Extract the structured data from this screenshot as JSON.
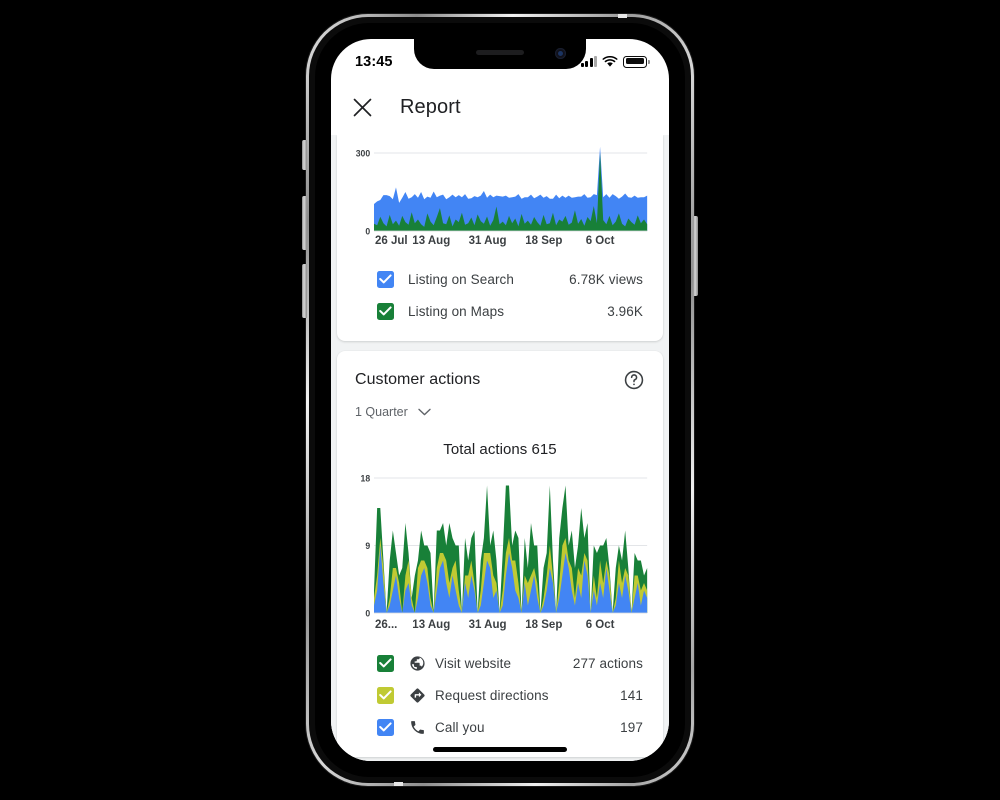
{
  "device": {
    "status_bar": {
      "time": "13:45",
      "cellular_icon": "signal-bars-icon",
      "wifi_icon": "wifi-icon",
      "battery_icon": "battery-icon"
    },
    "home_indicator": "home-indicator"
  },
  "header": {
    "close_icon": "close-icon",
    "title": "Report"
  },
  "views_card": {
    "legend": [
      {
        "label": "Listing on Search",
        "value": "6.78K views",
        "color": "#4285F4",
        "checked": true
      },
      {
        "label": "Listing on Maps",
        "value": "3.96K",
        "color": "#188038",
        "checked": true
      }
    ]
  },
  "actions_card": {
    "title": "Customer actions",
    "help_icon": "help-circle-icon",
    "period": "1 Quarter",
    "period_chevron_icon": "chevron-down-icon",
    "total": "Total actions 615",
    "legend": [
      {
        "label": "Visit website",
        "value": "277 actions",
        "color": "#188038",
        "icon": "globe-icon",
        "checked": true
      },
      {
        "label": "Request directions",
        "value": "141",
        "color": "#C0CA33",
        "icon": "directions-icon",
        "checked": true
      },
      {
        "label": "Call you",
        "value": "197",
        "color": "#4285F4",
        "icon": "phone-icon",
        "checked": true
      }
    ]
  },
  "chart_data": [
    {
      "id": "views_chart",
      "type": "area",
      "stacked": true,
      "title": "",
      "xlabel": "",
      "ylabel": "",
      "ylim": [
        0,
        300
      ],
      "yticks": [
        0,
        300
      ],
      "ytick_labels": [
        "0",
        "300"
      ],
      "grid": true,
      "legend_position": "below",
      "xtick_labels": [
        "26 Jul",
        "13 Aug",
        "31 Aug",
        "18 Sep",
        "6 Oct"
      ],
      "xtick_positions": [
        0,
        18,
        36,
        54,
        72
      ],
      "x_count": 88,
      "series": [
        {
          "name": "Listing on Maps",
          "color": "#188038",
          "values": [
            28,
            22,
            55,
            30,
            18,
            62,
            26,
            40,
            20,
            58,
            34,
            24,
            72,
            30,
            44,
            26,
            16,
            68,
            36,
            22,
            54,
            88,
            30,
            26,
            60,
            18,
            44,
            34,
            70,
            24,
            30,
            52,
            22,
            64,
            38,
            28,
            56,
            20,
            42,
            94,
            26,
            36,
            22,
            58,
            30,
            48,
            18,
            66,
            28,
            40,
            24,
            54,
            34,
            20,
            62,
            26,
            30,
            70,
            22,
            44,
            36,
            58,
            24,
            32,
            80,
            28,
            46,
            20,
            54,
            38,
            96,
            30,
            300,
            42,
            26,
            58,
            22,
            36,
            68,
            28,
            18,
            48,
            34,
            24,
            60,
            30,
            44,
            26
          ]
        },
        {
          "name": "Listing on Search",
          "color": "#4285F4",
          "values": [
            76,
            92,
            64,
            108,
            120,
            72,
            96,
            128,
            88,
            70,
            116,
            100,
            58,
            112,
            84,
            124,
            106,
            64,
            92,
            130,
            76,
            48,
            110,
            96,
            70,
            122,
            86,
            104,
            60,
            118,
            94,
            74,
            112,
            66,
            98,
            126,
            72,
            120,
            88,
            42,
            108,
            96,
            114,
            70,
            100,
            84,
            124,
            58,
            102,
            90,
            116,
            72,
            98,
            120,
            66,
            108,
            94,
            54,
            118,
            82,
            100,
            70,
            112,
            96,
            50,
            104,
            86,
            122,
            74,
            92,
            46,
            108,
            24,
            88,
            116,
            70,
            120,
            98,
            56,
            104,
            126,
            82,
            94,
            112,
            68,
            100,
            86,
            110
          ]
        }
      ]
    },
    {
      "id": "actions_chart",
      "type": "area",
      "stacked": true,
      "title": "Total actions 615",
      "xlabel": "",
      "ylabel": "",
      "ylim": [
        0,
        18
      ],
      "yticks": [
        0,
        9,
        18
      ],
      "ytick_labels": [
        "0",
        "9",
        "18"
      ],
      "grid": true,
      "legend_position": "below",
      "xtick_labels": [
        "26...",
        "13 Aug",
        "31 Aug",
        "18 Sep",
        "6 Oct"
      ],
      "xtick_positions": [
        0,
        18,
        36,
        54,
        72
      ],
      "x_count": 88,
      "series": [
        {
          "name": "Call you",
          "color": "#4285F4",
          "values": [
            1,
            3,
            9,
            4,
            0,
            1,
            3,
            5,
            2,
            0,
            3,
            4,
            1,
            0,
            2,
            5,
            6,
            4,
            1,
            0,
            3,
            6,
            7,
            4,
            2,
            5,
            3,
            1,
            0,
            4,
            2,
            5,
            3,
            0,
            1,
            4,
            7,
            6,
            2,
            3,
            0,
            1,
            5,
            8,
            6,
            3,
            2,
            0,
            4,
            1,
            3,
            5,
            2,
            0,
            1,
            3,
            6,
            4,
            0,
            2,
            5,
            8,
            6,
            3,
            1,
            4,
            2,
            7,
            5,
            0,
            3,
            1,
            4,
            2,
            6,
            3,
            0,
            1,
            4,
            2,
            5,
            3,
            0,
            2,
            4,
            1,
            3,
            2
          ]
        },
        {
          "name": "Request directions",
          "color": "#C0CA33",
          "values": [
            1,
            2,
            1,
            2,
            0,
            1,
            3,
            1,
            2,
            0,
            2,
            3,
            1,
            0,
            4,
            2,
            1,
            2,
            1,
            0,
            3,
            2,
            1,
            3,
            2,
            1,
            4,
            2,
            0,
            1,
            3,
            2,
            1,
            0,
            2,
            4,
            1,
            2,
            3,
            1,
            0,
            2,
            3,
            2,
            1,
            4,
            2,
            0,
            1,
            3,
            2,
            1,
            2,
            0,
            1,
            2,
            3,
            1,
            0,
            2,
            4,
            2,
            1,
            3,
            1,
            2,
            3,
            1,
            2,
            0,
            2,
            1,
            3,
            2,
            1,
            2,
            0,
            1,
            3,
            2,
            1,
            2,
            0,
            3,
            1,
            2,
            1,
            1
          ]
        },
        {
          "name": "Visit website",
          "color": "#188038",
          "values": [
            1,
            9,
            4,
            1,
            0,
            5,
            5,
            2,
            1,
            6,
            7,
            1,
            0,
            5,
            1,
            4,
            2,
            3,
            6,
            0,
            5,
            3,
            4,
            2,
            8,
            4,
            2,
            6,
            0,
            5,
            2,
            3,
            7,
            0,
            4,
            2,
            9,
            1,
            6,
            3,
            0,
            5,
            9,
            7,
            2,
            4,
            6,
            0,
            5,
            2,
            7,
            3,
            5,
            0,
            4,
            3,
            8,
            2,
            0,
            6,
            5,
            7,
            2,
            5,
            4,
            3,
            9,
            2,
            5,
            0,
            4,
            6,
            2,
            5,
            3,
            1,
            0,
            4,
            2,
            3,
            5,
            1,
            0,
            3,
            2,
            4,
            1,
            3
          ]
        }
      ]
    }
  ]
}
